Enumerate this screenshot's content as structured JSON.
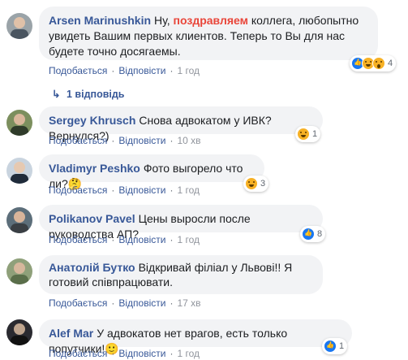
{
  "actions": {
    "like": "Подобається",
    "reply": "Відповісти"
  },
  "comments": [
    {
      "author": "Arsen Marinushkin",
      "text_before": "Ну,",
      "highlight": "поздравляем",
      "text_after": "коллега, любопытно увидеть Вашим первых клиентов. Теперь то Вы для нас будете точно досягаемы.",
      "time": "1 год",
      "reactions": [
        "like",
        "haha",
        "wow"
      ],
      "reaction_count": "4",
      "replies_label": "1 відповідь"
    },
    {
      "author": "Sergey Khrusch",
      "text": "Снова адвокатом у ИВК? Вернулся?)",
      "time": "10 хв",
      "reactions": [
        "haha"
      ],
      "reaction_count": "1"
    },
    {
      "author": "Vladimyr Peshko",
      "text": "Фото выгорело что ли?",
      "emoji": "🤔",
      "time": "1 год",
      "reactions": [
        "haha"
      ],
      "reaction_count": "3"
    },
    {
      "author": "Polikanov Pavel",
      "text": "Цены выросли после руководства АП?",
      "time": "1 год",
      "reactions": [
        "like"
      ],
      "reaction_count": "8"
    },
    {
      "author": "Анатолій Бутко",
      "text": "Відкривай філіал у Львові!! Я готовий співпрацювати.",
      "time": "17 хв",
      "reactions": [],
      "reaction_count": ""
    },
    {
      "author": "Alef Mar",
      "text": "У адвокатов нет врагов, есть только попутчики!",
      "emoji": "🙂",
      "time": "1 год",
      "reactions": [
        "like"
      ],
      "reaction_count": "1"
    }
  ]
}
